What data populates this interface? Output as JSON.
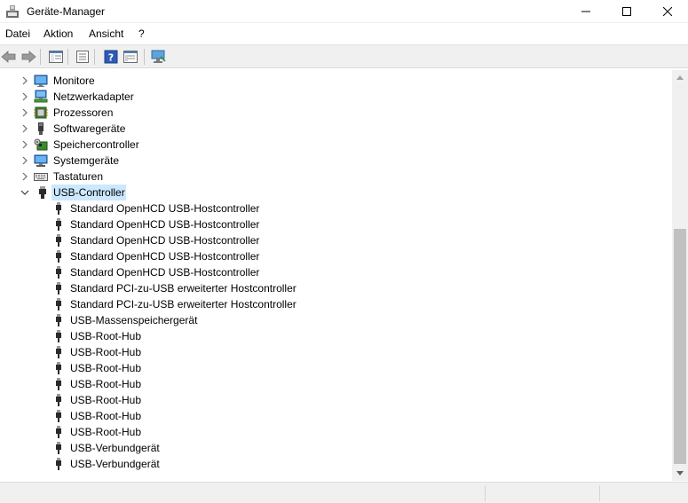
{
  "window": {
    "title": "Geräte-Manager",
    "controls": {
      "minimize": "—",
      "maximize": "☐",
      "close": "✕"
    }
  },
  "menu": {
    "items": [
      "Datei",
      "Aktion",
      "Ansicht",
      "?"
    ]
  },
  "toolbar": {
    "buttons": [
      "back-icon",
      "forward-icon",
      "show-hide-tree-icon",
      "properties-icon",
      "help-icon",
      "action-view-icon",
      "scan-hardware-icon"
    ]
  },
  "tree": {
    "categories": [
      {
        "label": "Monitore",
        "icon": "monitor-icon",
        "expanded": false
      },
      {
        "label": "Netzwerkadapter",
        "icon": "network-adapter-icon",
        "expanded": false
      },
      {
        "label": "Prozessoren",
        "icon": "processor-icon",
        "expanded": false
      },
      {
        "label": "Softwaregeräte",
        "icon": "software-device-icon",
        "expanded": false
      },
      {
        "label": "Speichercontroller",
        "icon": "storage-controller-icon",
        "expanded": false
      },
      {
        "label": "Systemgeräte",
        "icon": "system-device-icon",
        "expanded": false
      },
      {
        "label": "Tastaturen",
        "icon": "keyboard-icon",
        "expanded": false
      },
      {
        "label": "USB-Controller",
        "icon": "usb-icon",
        "expanded": true,
        "selected": true
      }
    ],
    "usb_children": [
      "Standard OpenHCD USB-Hostcontroller",
      "Standard OpenHCD USB-Hostcontroller",
      "Standard OpenHCD USB-Hostcontroller",
      "Standard OpenHCD USB-Hostcontroller",
      "Standard OpenHCD USB-Hostcontroller",
      "Standard PCI-zu-USB erweiterter Hostcontroller",
      "Standard PCI-zu-USB erweiterter Hostcontroller",
      "USB-Massenspeichergerät",
      "USB-Root-Hub",
      "USB-Root-Hub",
      "USB-Root-Hub",
      "USB-Root-Hub",
      "USB-Root-Hub",
      "USB-Root-Hub",
      "USB-Root-Hub",
      "USB-Verbundgerät",
      "USB-Verbundgerät"
    ]
  },
  "colors": {
    "selection": "#cce8ff",
    "toolbar_bg": "#f0f0f0",
    "scroll_thumb": "#c1c1c1"
  }
}
